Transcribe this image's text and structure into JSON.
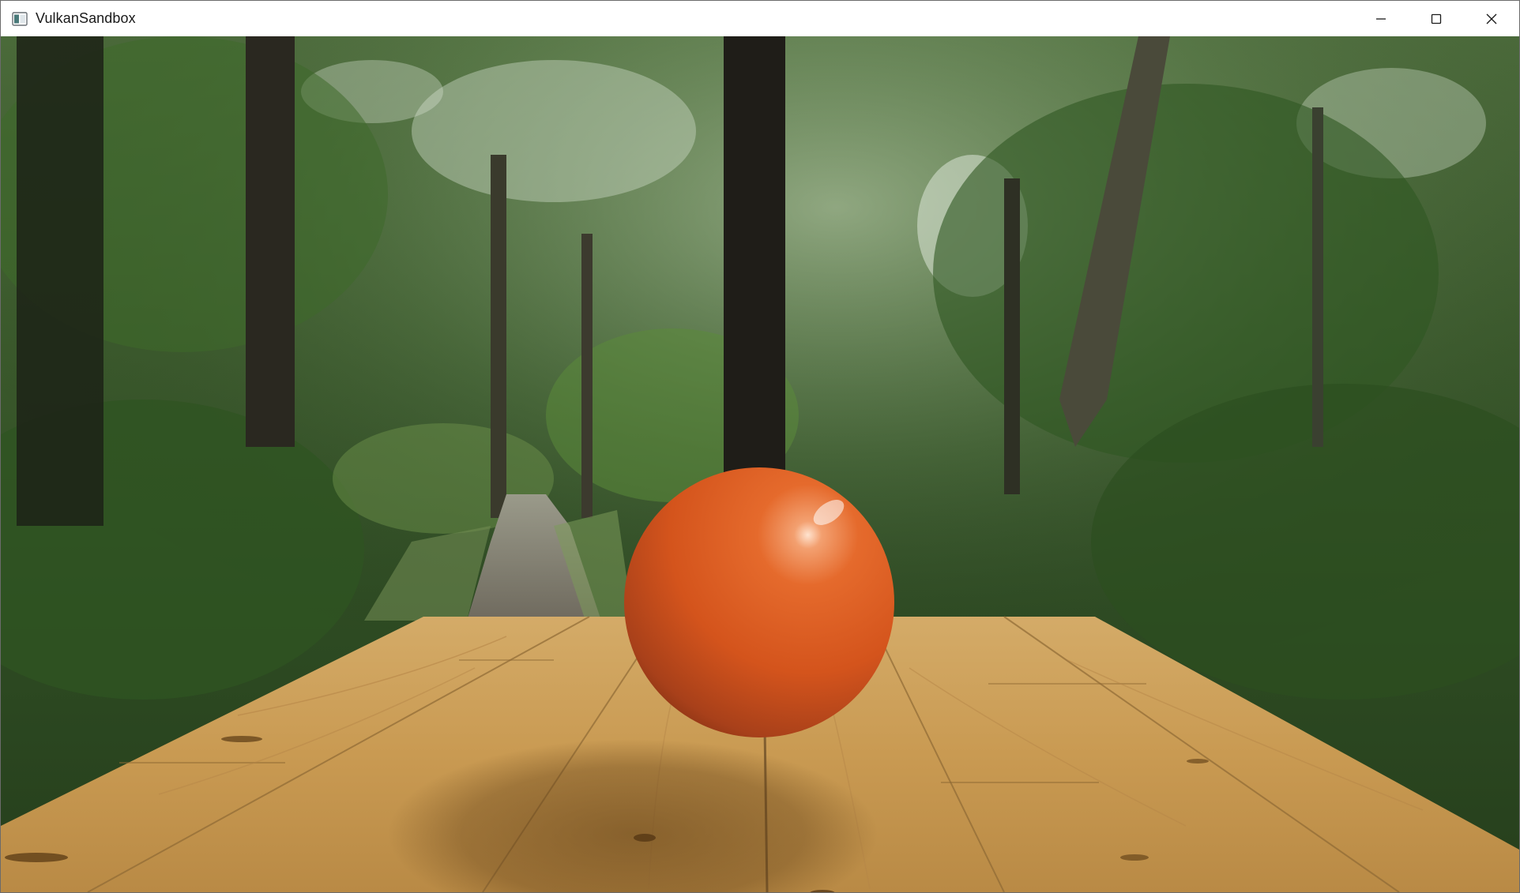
{
  "window": {
    "title": "VulkanSandbox",
    "app_icon": "application-window-icon"
  },
  "caption_buttons": [
    {
      "name": "minimize-button",
      "icon": "minimize-icon"
    },
    {
      "name": "maximize-button",
      "icon": "maximize-icon"
    },
    {
      "name": "close-button",
      "icon": "close-icon"
    }
  ],
  "scene": {
    "background": "forest-environment-skybox",
    "objects": [
      "wooden-plank-table",
      "orange-sphere",
      "sphere-shadow"
    ],
    "colors": {
      "sphere": "#d9541e",
      "table": "#c79a55",
      "foliage": "#3f6a2c"
    }
  }
}
